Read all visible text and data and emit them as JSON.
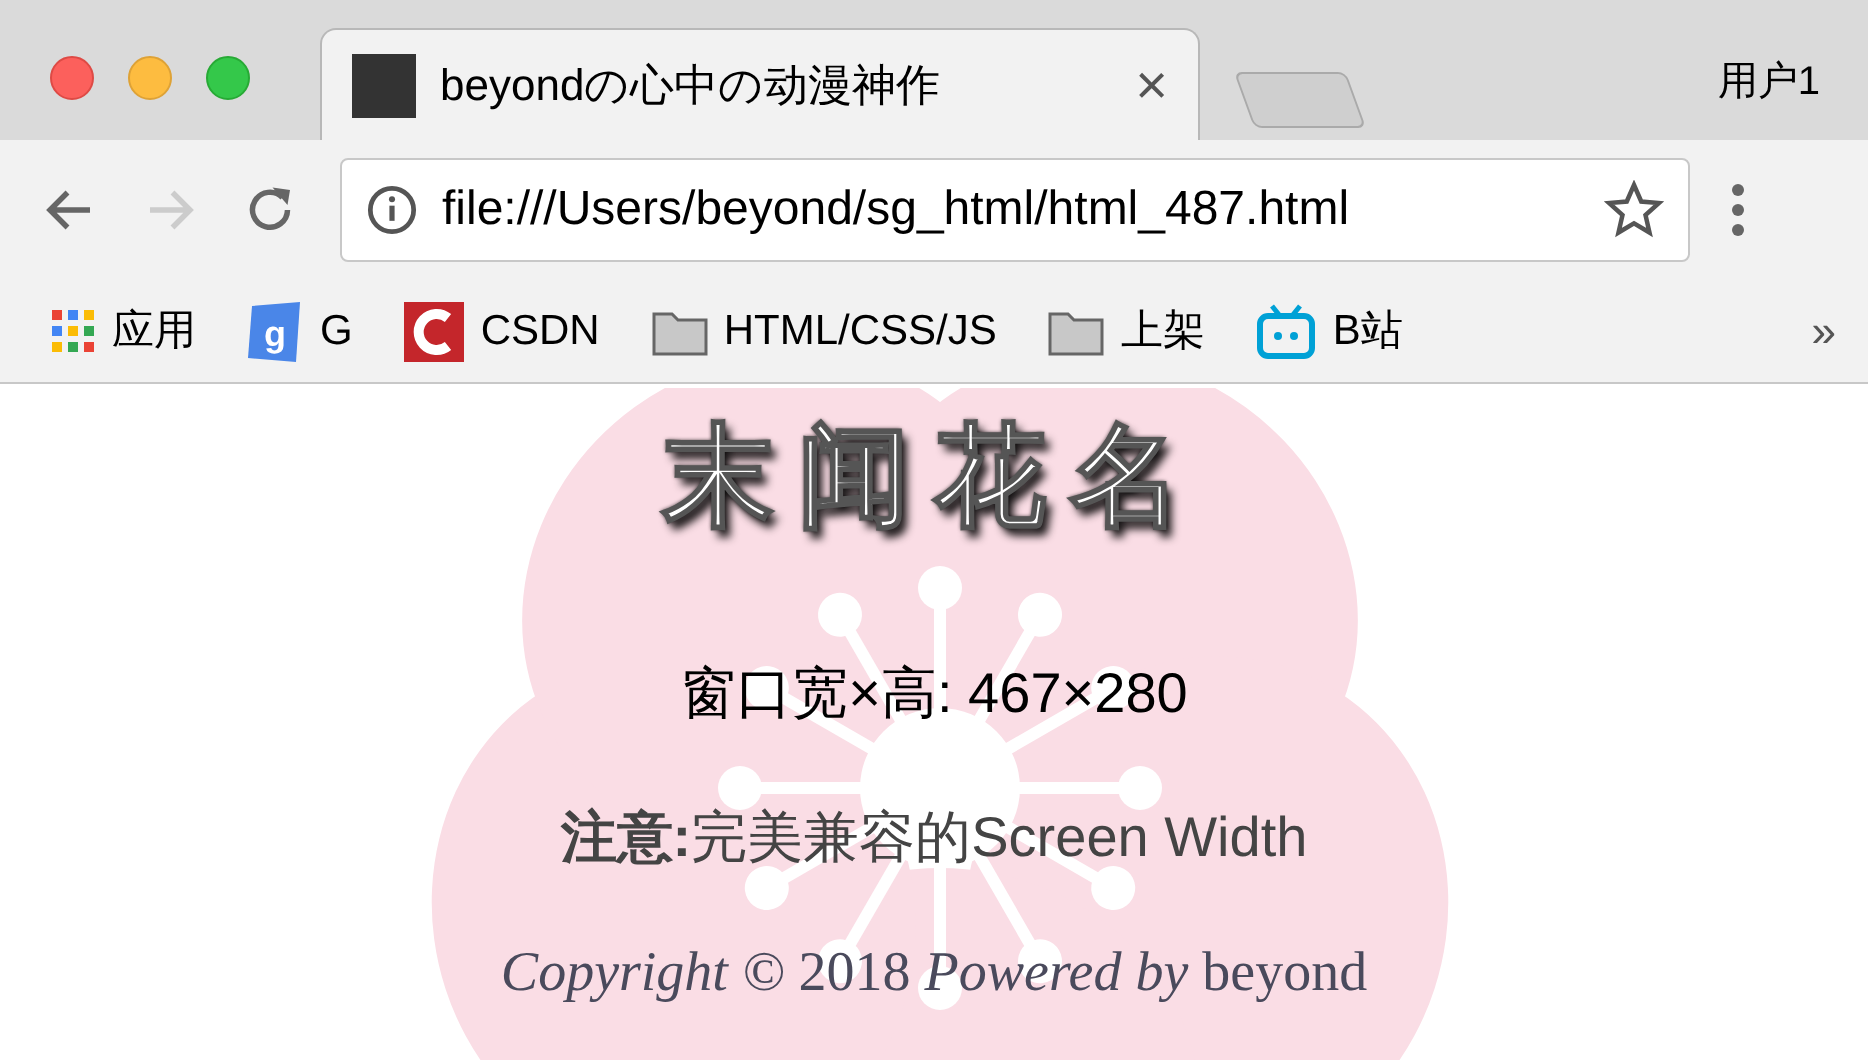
{
  "tab": {
    "title": "beyondの心中の动漫神作",
    "close": "×"
  },
  "profile": "用户1",
  "address": {
    "url": "file:///Users/beyond/sg_html/html_487.html"
  },
  "bookmarks": [
    {
      "kind": "apps",
      "label": "应用"
    },
    {
      "kind": "g",
      "label": "G"
    },
    {
      "kind": "csdn",
      "label": "CSDN"
    },
    {
      "kind": "folder",
      "label": "HTML/CSS/JS"
    },
    {
      "kind": "folder",
      "label": "上架"
    },
    {
      "kind": "bili",
      "label": "B站"
    }
  ],
  "bookmarks_more": "»",
  "page": {
    "title": "末闻花名",
    "size_line": "窗口宽×高: 467×280",
    "note": "**注意:**完美兼容的Screen Width",
    "footer": "*Copyright ©* 2018 *Powered by* beyond"
  }
}
